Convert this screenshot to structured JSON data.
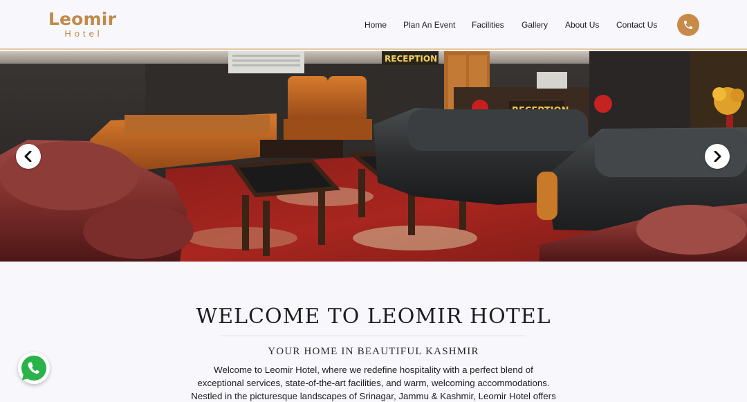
{
  "brand": {
    "name": "Leomir",
    "subtitle": "Hotel",
    "color": "#c08a4a"
  },
  "nav": {
    "items": [
      {
        "label": "Home"
      },
      {
        "label": "Plan An Event"
      },
      {
        "label": "Facilities"
      },
      {
        "label": "Gallery"
      },
      {
        "label": "About Us"
      },
      {
        "label": "Contact Us"
      }
    ],
    "phone_icon": "phone-icon"
  },
  "hero": {
    "image_signs": [
      "RECEPTION",
      "RECEPTION"
    ],
    "prev_icon": "chevron-left-icon",
    "next_icon": "chevron-right-icon"
  },
  "welcome": {
    "title": "WELCOME TO LEOMIR HOTEL",
    "subtitle": "YOUR HOME IN BEAUTIFUL KASHMIR",
    "body_lines": [
      "Welcome to Leomir Hotel, where we redefine hospitality with a perfect blend of",
      "exceptional services, state-of-the-art facilities, and warm, welcoming accommodations.",
      "Nestled in the picturesque landscapes of Srinagar, Jammu & Kashmir, Leomir Hotel offers"
    ]
  },
  "floating": {
    "whatsapp_icon": "whatsapp-icon"
  }
}
